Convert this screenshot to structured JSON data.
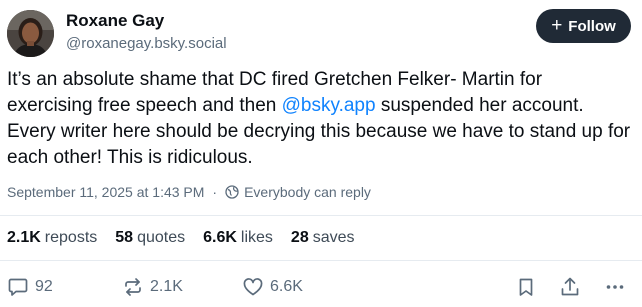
{
  "post": {
    "author": {
      "display_name": "Roxane Gay",
      "handle": "@roxanegay.bsky.social"
    },
    "follow_label": "Follow",
    "text_before_mention": "It’s an absolute shame that DC fired Gretchen Felker- Martin for exercising free speech and then ",
    "mention": "@bsky.app",
    "text_after_mention": " suspended her account. Every writer here should be decrying this because we have to stand up for each other! This is ridiculous.",
    "timestamp": "September 11, 2025 at 1:43 PM",
    "separator": "·",
    "reply_setting": "Everybody can reply"
  },
  "stats": {
    "reposts_count": "2.1K",
    "reposts_label": "reposts",
    "quotes_count": "58",
    "quotes_label": "quotes",
    "likes_count": "6.6K",
    "likes_label": "likes",
    "saves_count": "28",
    "saves_label": "saves"
  },
  "actions": {
    "reply_count": "92",
    "repost_count": "2.1K",
    "like_count": "6.6K"
  },
  "colors": {
    "accent": "#1083fe",
    "follow_button_bg": "#202a36",
    "muted_text": "#5b6b7b",
    "divider": "#e6ebf0"
  },
  "icons": [
    "avatar",
    "plus-icon",
    "globe-icon",
    "reply-icon",
    "repost-icon",
    "like-icon",
    "bookmark-icon",
    "share-icon",
    "more-icon"
  ]
}
